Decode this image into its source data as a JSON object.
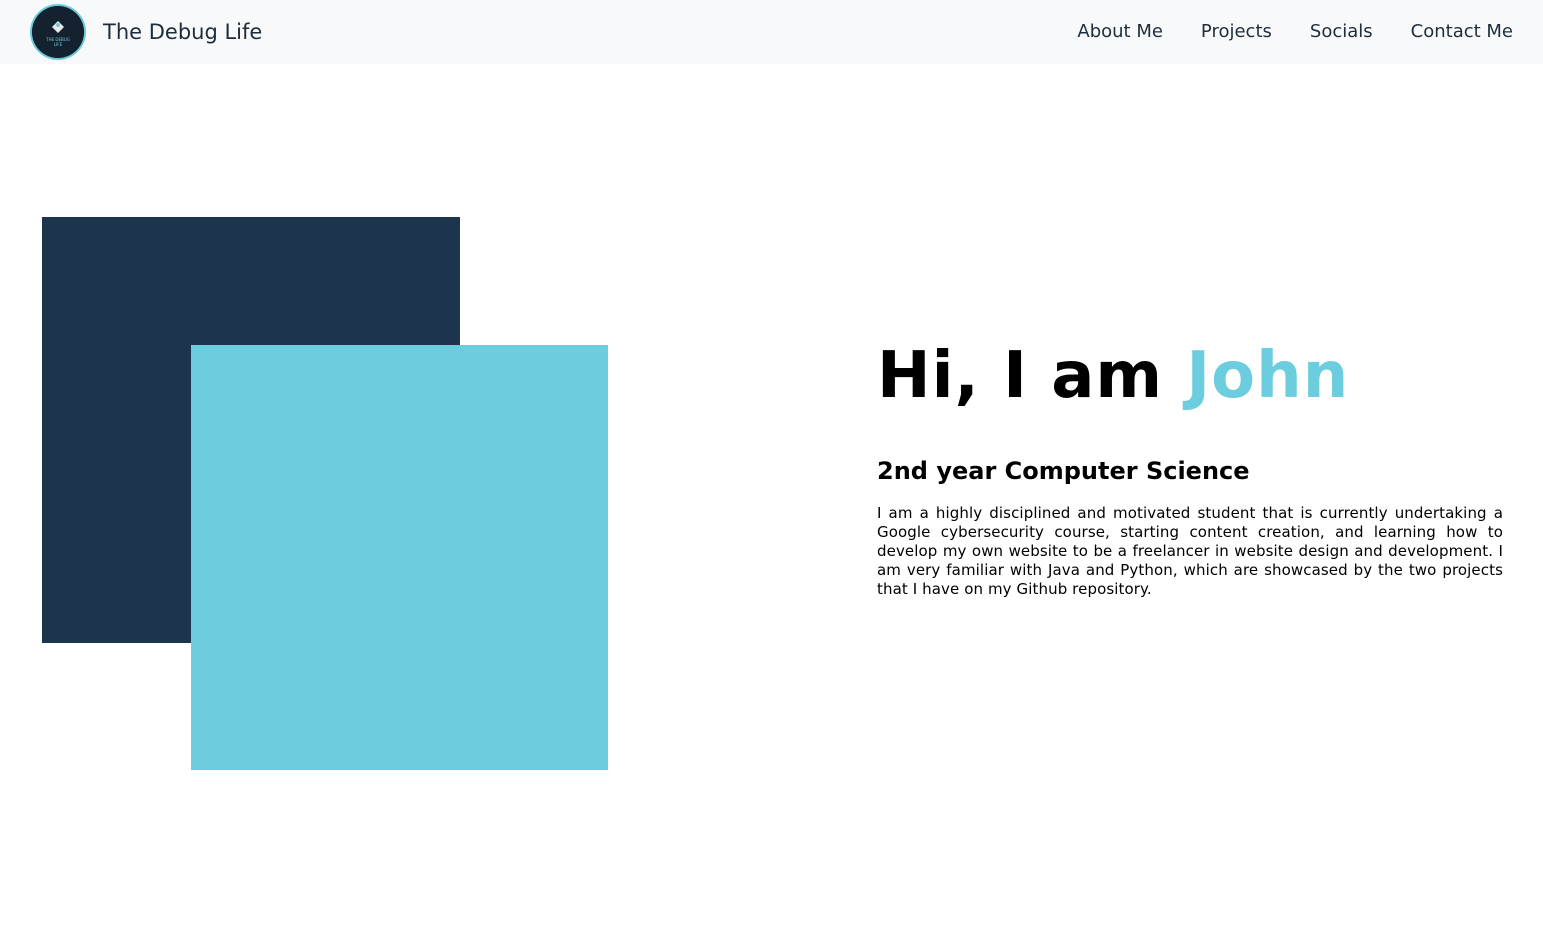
{
  "header": {
    "brand": "The Debug Life",
    "logo_text_line1": "THE DEBUG",
    "logo_text_line2": "LIFE"
  },
  "nav": {
    "items": [
      {
        "label": "About Me"
      },
      {
        "label": "Projects"
      },
      {
        "label": "Socials"
      },
      {
        "label": "Contact Me"
      }
    ]
  },
  "hero": {
    "greeting": "Hi, I am ",
    "name": "John",
    "subtitle": "2nd year Computer Science",
    "bio": "I am a highly disciplined and motivated student that is currently undertaking a Google cybersecurity course, starting content creation, and learning how to develop my own website to be a freelancer in website design and development. I am very familiar with Java and Python, which are showcased by the two projects that I have on my Github repository."
  },
  "colors": {
    "dark_square": "#1d344d",
    "light_square": "#6bcddd",
    "accent": "#6bcddd",
    "navbar_bg": "#f8f9fa"
  }
}
